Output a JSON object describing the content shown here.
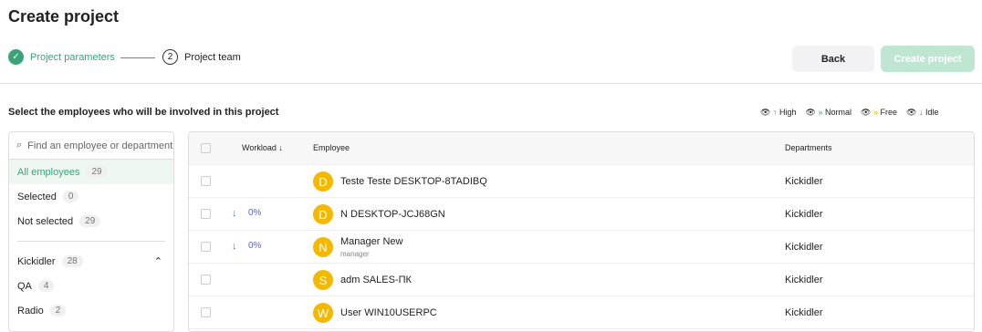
{
  "title": "Create project",
  "steps": {
    "s1": "Project parameters",
    "s2n": "2",
    "s2": "Project team"
  },
  "buttons": {
    "back": "Back",
    "create": "Create project"
  },
  "subtitle": "Select the employees who will be involved in this project",
  "legend": {
    "high": "High",
    "normal": "Normal",
    "free": "Free",
    "idle": "Idle"
  },
  "search": {
    "placeholder": "Find an employee or department"
  },
  "filters": [
    {
      "label": "All employees",
      "count": "29"
    },
    {
      "label": "Selected",
      "count": "0"
    },
    {
      "label": "Not selected",
      "count": "29"
    }
  ],
  "dept": {
    "label": "Kickidler",
    "count": "28"
  },
  "subdepts": [
    {
      "label": "QA",
      "count": "4"
    },
    {
      "label": "Radio",
      "count": "2"
    }
  ],
  "table": {
    "workload": "Workload",
    "employee": "Employee",
    "departments": "Departments"
  },
  "rows": [
    {
      "initial": "D",
      "name": "Teste Teste DESKTOP-8TADIBQ",
      "sub": "",
      "workload": "",
      "dept": "Kickidler"
    },
    {
      "initial": "D",
      "name": "N DESKTOP-JCJ68GN",
      "sub": "",
      "workload": "0%",
      "dept": "Kickidler"
    },
    {
      "initial": "N",
      "name": "Manager New",
      "sub": "manager",
      "workload": "0%",
      "dept": "Kickidler"
    },
    {
      "initial": "S",
      "name": "adm SALES-ПК",
      "sub": "",
      "workload": "",
      "dept": "Kickidler"
    },
    {
      "initial": "W",
      "name": "User WIN10USERPC",
      "sub": "",
      "workload": "",
      "dept": "Kickidler"
    }
  ]
}
